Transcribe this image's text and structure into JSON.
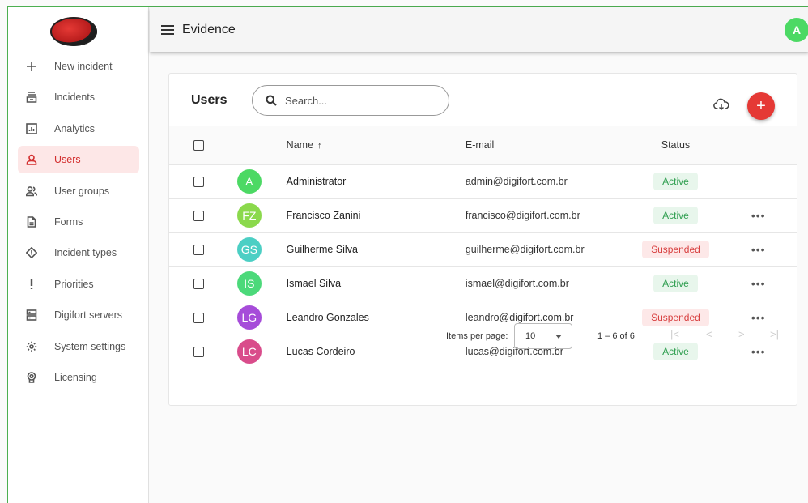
{
  "app": {
    "title": "Evidence",
    "avatar_letter": "A"
  },
  "sidebar": {
    "items": [
      {
        "label": "New incident",
        "icon": "plus-icon"
      },
      {
        "label": "Incidents",
        "icon": "inbox-icon"
      },
      {
        "label": "Analytics",
        "icon": "analytics-icon"
      },
      {
        "label": "Users",
        "icon": "user-icon",
        "active": true
      },
      {
        "label": "User groups",
        "icon": "users-icon"
      },
      {
        "label": "Forms",
        "icon": "document-icon"
      },
      {
        "label": "Incident types",
        "icon": "diamond-alert-icon"
      },
      {
        "label": "Priorities",
        "icon": "exclamation-icon"
      },
      {
        "label": "Digifort servers",
        "icon": "server-icon"
      },
      {
        "label": "System settings",
        "icon": "gear-icon"
      },
      {
        "label": "Licensing",
        "icon": "badge-icon"
      }
    ]
  },
  "users_card": {
    "title": "Users",
    "search_placeholder": "Search...",
    "columns": {
      "name": "Name",
      "email": "E-mail",
      "status": "Status"
    },
    "rows": [
      {
        "initials": "A",
        "color": "#4cd964",
        "name": "Administrator",
        "email": "admin@digifort.com.br",
        "status": "Active",
        "menu": false
      },
      {
        "initials": "FZ",
        "color": "#8bd94c",
        "name": "Francisco Zanini",
        "email": "francisco@digifort.com.br",
        "status": "Active",
        "menu": true
      },
      {
        "initials": "GS",
        "color": "#4ccfc4",
        "name": "Guilherme Silva",
        "email": "guilherme@digifort.com.br",
        "status": "Suspended",
        "menu": true
      },
      {
        "initials": "IS",
        "color": "#4cd97a",
        "name": "Ismael Silva",
        "email": "ismael@digifort.com.br",
        "status": "Active",
        "menu": true
      },
      {
        "initials": "LG",
        "color": "#a64cd9",
        "name": "Leandro Gonzales",
        "email": "leandro@digifort.com.br",
        "status": "Suspended",
        "menu": true
      },
      {
        "initials": "LC",
        "color": "#d94c8b",
        "name": "Lucas Cordeiro",
        "email": "lucas@digifort.com.br",
        "status": "Active",
        "menu": true
      }
    ],
    "paginator": {
      "items_per_page_label": "Items per page:",
      "items_per_page": "10",
      "range": "1 – 6 of 6"
    }
  },
  "colors": {
    "accent": "#e53935",
    "active_bg": "#fde7e7",
    "status_active": "#2e9e4f",
    "status_suspended": "#d84040"
  }
}
